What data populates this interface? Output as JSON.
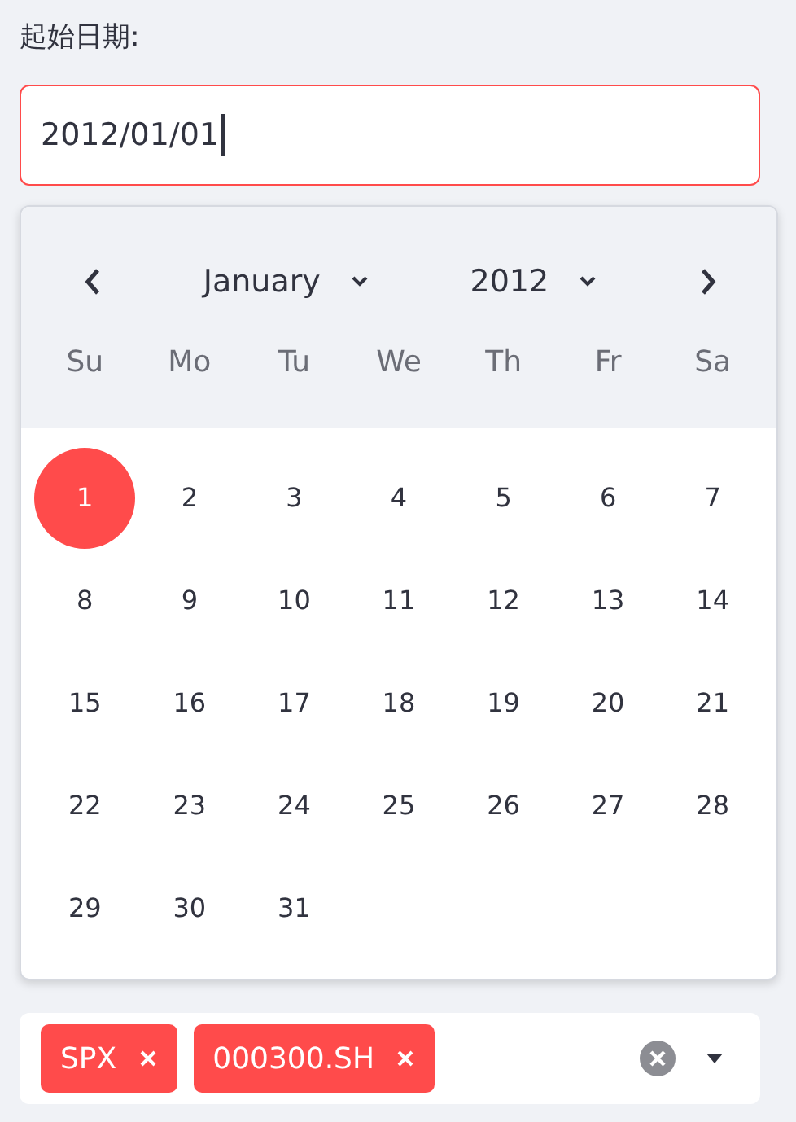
{
  "date_field": {
    "label": "起始日期:",
    "value": "2012/01/01",
    "focused": true
  },
  "calendar": {
    "month": "January",
    "year": "2012",
    "weekdays": [
      "Su",
      "Mo",
      "Tu",
      "We",
      "Th",
      "Fr",
      "Sa"
    ],
    "days": [
      {
        "day": "1",
        "selected": true
      },
      {
        "day": "2",
        "selected": false
      },
      {
        "day": "3",
        "selected": false
      },
      {
        "day": "4",
        "selected": false
      },
      {
        "day": "5",
        "selected": false
      },
      {
        "day": "6",
        "selected": false
      },
      {
        "day": "7",
        "selected": false
      },
      {
        "day": "8",
        "selected": false
      },
      {
        "day": "9",
        "selected": false
      },
      {
        "day": "10",
        "selected": false
      },
      {
        "day": "11",
        "selected": false
      },
      {
        "day": "12",
        "selected": false
      },
      {
        "day": "13",
        "selected": false
      },
      {
        "day": "14",
        "selected": false
      },
      {
        "day": "15",
        "selected": false
      },
      {
        "day": "16",
        "selected": false
      },
      {
        "day": "17",
        "selected": false
      },
      {
        "day": "18",
        "selected": false
      },
      {
        "day": "19",
        "selected": false
      },
      {
        "day": "20",
        "selected": false
      },
      {
        "day": "21",
        "selected": false
      },
      {
        "day": "22",
        "selected": false
      },
      {
        "day": "23",
        "selected": false
      },
      {
        "day": "24",
        "selected": false
      },
      {
        "day": "25",
        "selected": false
      },
      {
        "day": "26",
        "selected": false
      },
      {
        "day": "27",
        "selected": false
      },
      {
        "day": "28",
        "selected": false
      },
      {
        "day": "29",
        "selected": false
      },
      {
        "day": "30",
        "selected": false
      },
      {
        "day": "31",
        "selected": false
      }
    ]
  },
  "multiselect": {
    "tags": [
      "SPX",
      "000300.SH"
    ]
  }
}
